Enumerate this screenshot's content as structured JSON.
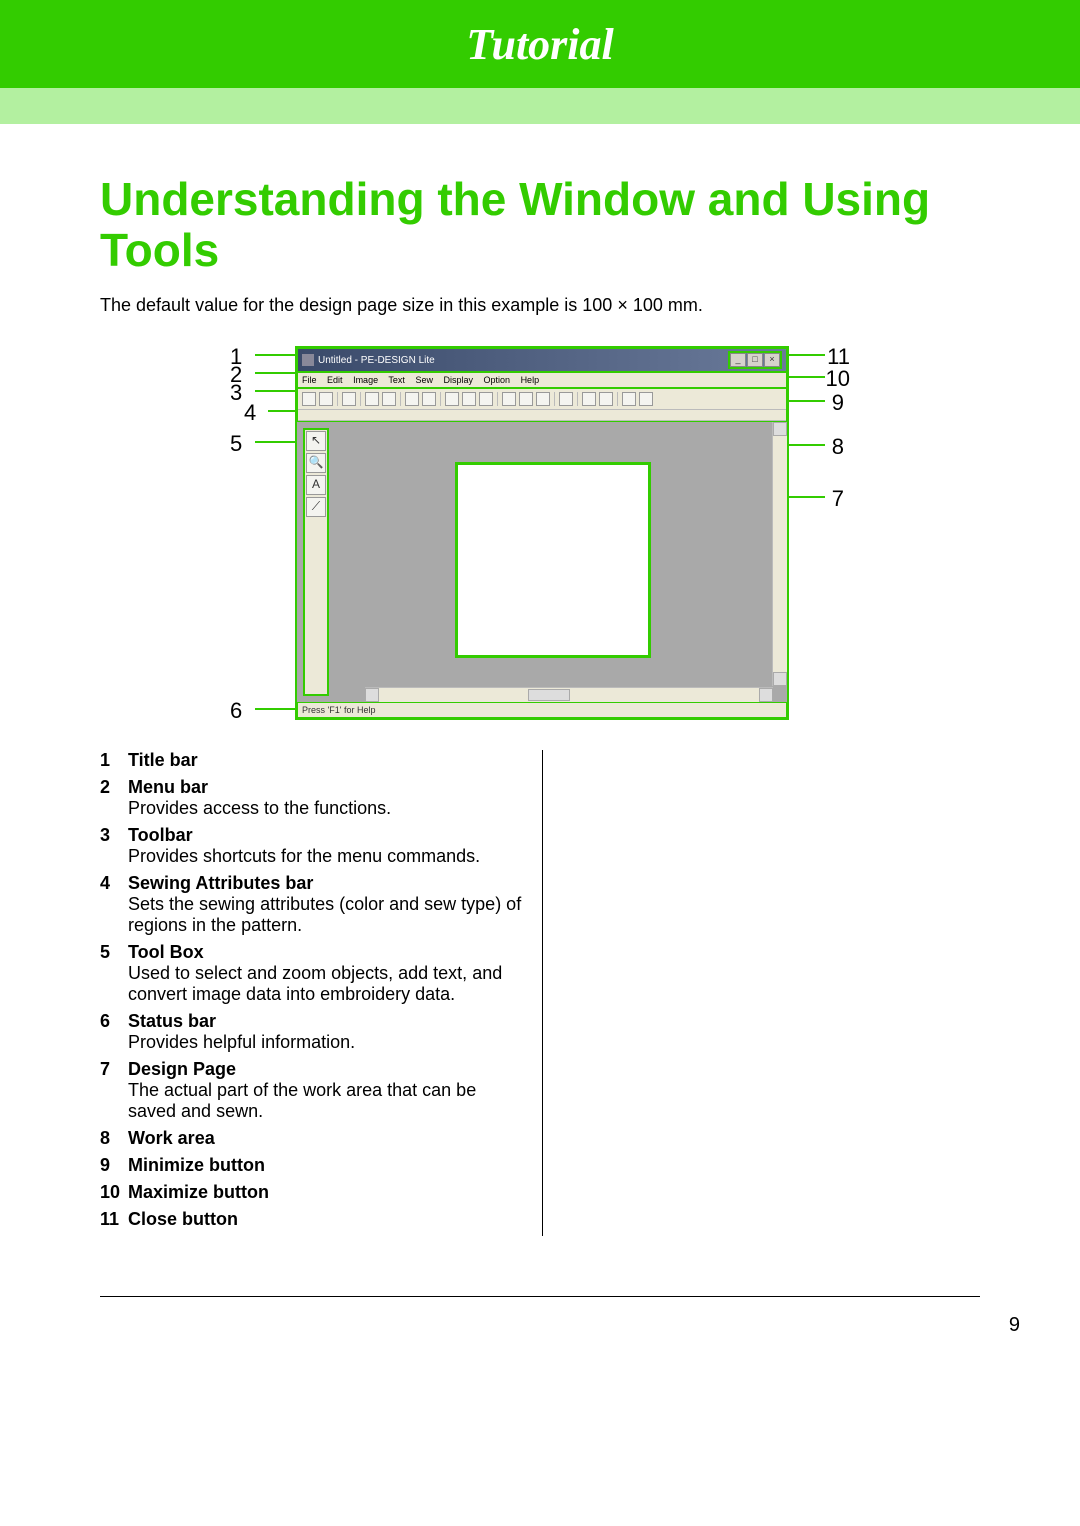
{
  "header": {
    "title": "Tutorial"
  },
  "section": {
    "title": "Understanding the Window and Using Tools",
    "intro": "The default value for the design page size in this example is 100 × 100 mm."
  },
  "callouts_left": [
    "1",
    "2",
    "3",
    "4",
    "5",
    "6"
  ],
  "callouts_right": [
    "11",
    "10",
    "9",
    "8",
    "7"
  ],
  "app": {
    "title": "Untitled - PE-DESIGN Lite",
    "menus": [
      "File",
      "Edit",
      "Image",
      "Text",
      "Sew",
      "Display",
      "Option",
      "Help"
    ],
    "status": "Press 'F1' for Help",
    "tools": [
      "↖",
      "🔍",
      "A",
      "⟋"
    ],
    "win_btns": [
      "_",
      "□",
      "×"
    ]
  },
  "legend": [
    {
      "n": "1",
      "title": "Title bar",
      "desc": ""
    },
    {
      "n": "2",
      "title": "Menu bar",
      "desc": "Provides access to the functions."
    },
    {
      "n": "3",
      "title": "Toolbar",
      "desc": "Provides shortcuts for the menu commands."
    },
    {
      "n": "4",
      "title": "Sewing Attributes bar",
      "desc": "Sets the sewing attributes (color and sew type) of regions in the pattern."
    },
    {
      "n": "5",
      "title": "Tool Box",
      "desc": "Used to select and zoom objects, add text, and convert image data into embroidery data."
    },
    {
      "n": "6",
      "title": "Status bar",
      "desc": "Provides helpful information."
    },
    {
      "n": "7",
      "title": "Design Page",
      "desc": "The actual part of the work area that can be saved and sewn."
    },
    {
      "n": "8",
      "title": "Work area",
      "desc": ""
    },
    {
      "n": "9",
      "title": "Minimize button",
      "desc": ""
    },
    {
      "n": "10",
      "title": "Maximize button",
      "desc": ""
    },
    {
      "n": "11",
      "title": "Close button",
      "desc": ""
    }
  ],
  "page_number": "9"
}
